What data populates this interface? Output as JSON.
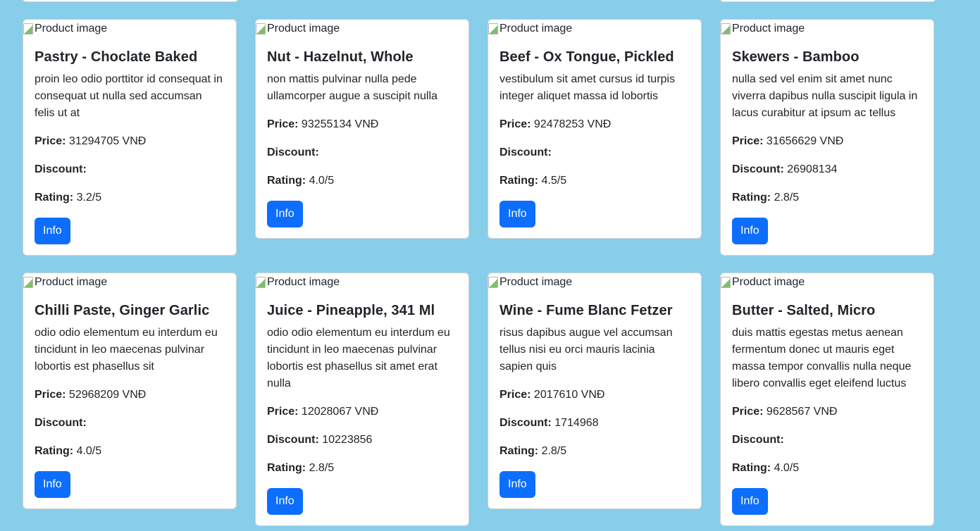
{
  "labels": {
    "image_alt": "Product image",
    "price": "Price:",
    "discount": "Discount:",
    "rating": "Rating:",
    "info_button": "Info"
  },
  "products": [
    {
      "title": "Pastry - Choclate Baked",
      "description": "proin leo odio porttitor id consequat in consequat ut nulla sed accumsan felis ut at",
      "price": "31294705 VNĐ",
      "discount": "",
      "rating": "3.2/5"
    },
    {
      "title": "Nut - Hazelnut, Whole",
      "description": "non mattis pulvinar nulla pede ullamcorper augue a suscipit nulla",
      "price": "93255134 VNĐ",
      "discount": "",
      "rating": "4.0/5"
    },
    {
      "title": "Beef - Ox Tongue, Pickled",
      "description": "vestibulum sit amet cursus id turpis integer aliquet massa id lobortis",
      "price": "92478253 VNĐ",
      "discount": "",
      "rating": "4.5/5"
    },
    {
      "title": "Skewers - Bamboo",
      "description": "nulla sed vel enim sit amet nunc viverra dapibus nulla suscipit ligula in lacus curabitur at ipsum ac tellus",
      "price": "31656629 VNĐ",
      "discount": "26908134",
      "rating": "2.8/5"
    },
    {
      "title": "Chilli Paste, Ginger Garlic",
      "description": "odio odio elementum eu interdum eu tincidunt in leo maecenas pulvinar lobortis est phasellus sit",
      "price": "52968209 VNĐ",
      "discount": "",
      "rating": "4.0/5"
    },
    {
      "title": "Juice - Pineapple, 341 Ml",
      "description": "odio odio elementum eu interdum eu tincidunt in leo maecenas pulvinar lobortis est phasellus sit amet erat nulla",
      "price": "12028067 VNĐ",
      "discount": "10223856",
      "rating": "2.8/5"
    },
    {
      "title": "Wine - Fume Blanc Fetzer",
      "description": "risus dapibus augue vel accumsan tellus nisi eu orci mauris lacinia sapien quis",
      "price": "2017610 VNĐ",
      "discount": "1714968",
      "rating": "2.8/5"
    },
    {
      "title": "Butter - Salted, Micro",
      "description": "duis mattis egestas metus aenean fermentum donec ut mauris eget massa tempor convallis nulla neque libero convallis eget eleifend luctus",
      "price": "9628567 VNĐ",
      "discount": "",
      "rating": "4.0/5"
    }
  ]
}
